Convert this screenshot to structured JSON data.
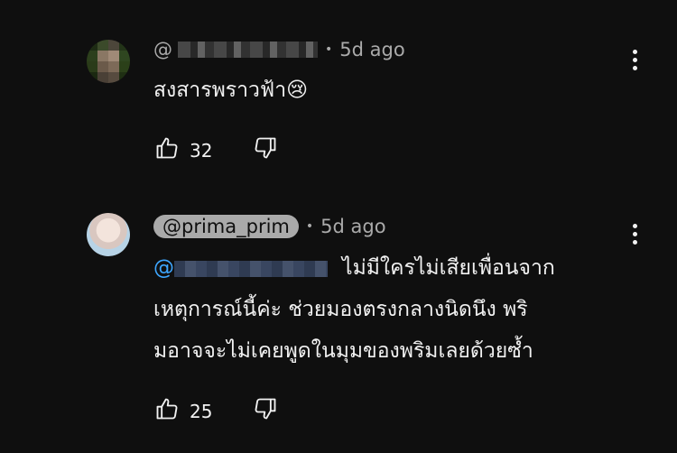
{
  "comments": [
    {
      "handle_prefix": "@",
      "time": "5d ago",
      "text": "สงสารพราวฟ้า",
      "emoji": "😢",
      "likes": "32"
    },
    {
      "handle": "@prima_prim",
      "time": "5d ago",
      "mention_prefix": "@",
      "text_line1": "ไม่มีใครไม่เสียเพื่อนจาก",
      "text_line2": "เหตุการณ์นี้ค่ะ ช่วยมองตรงกลางนิดนึง พริ",
      "text_line3": "มอาจจะไม่เคยพูดในมุมของพริมเลยด้วยซ้ำ",
      "likes": "25"
    }
  ],
  "icons": {
    "like": "thumbs-up-icon",
    "dislike": "thumbs-down-icon",
    "menu": "vertical-dots-icon"
  }
}
